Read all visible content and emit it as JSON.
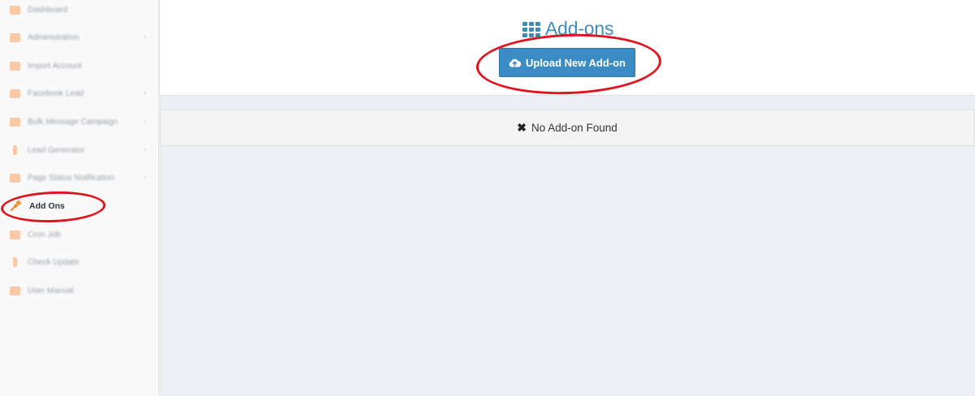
{
  "sidebar": {
    "items": [
      {
        "label": "Dashboard",
        "has_submenu": false
      },
      {
        "label": "Administration",
        "has_submenu": true
      },
      {
        "label": "Import Account",
        "has_submenu": false
      },
      {
        "label": "Facebook Lead",
        "has_submenu": true
      },
      {
        "label": "Bulk Message Campaign",
        "has_submenu": true
      },
      {
        "label": "Lead Generator",
        "has_submenu": true
      },
      {
        "label": "Page Status Notification",
        "has_submenu": true
      },
      {
        "label": "Add Ons",
        "has_submenu": false,
        "active": true
      },
      {
        "label": "Cron Job",
        "has_submenu": false
      },
      {
        "label": "Check Update",
        "has_submenu": false
      },
      {
        "label": "User Manual",
        "has_submenu": false
      }
    ],
    "chevron": "›"
  },
  "header": {
    "title": "Add-ons",
    "title_icon": "grid-icon",
    "upload_button_label": "Upload New Add-on",
    "upload_button_icon": "cloud-upload-icon"
  },
  "empty_state": {
    "icon": "✖",
    "message": "No Add-on Found"
  },
  "colors": {
    "accent": "#3c8dbc",
    "nav_icon": "#f7a35c",
    "annotation": "#e0141e"
  }
}
